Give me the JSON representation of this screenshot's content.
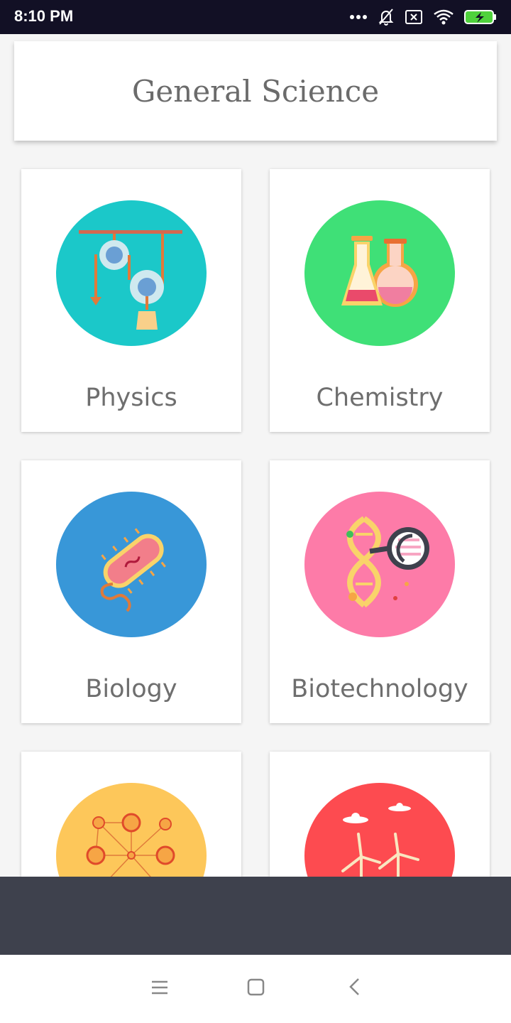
{
  "status_bar": {
    "time": "8:10 PM",
    "icons": [
      "more-dots-icon",
      "bell-off-icon",
      "sim-x-icon",
      "wifi-icon",
      "battery-charging-icon"
    ]
  },
  "header": {
    "title": "General Science"
  },
  "categories": [
    {
      "label": "Physics",
      "icon": "pulley-icon",
      "color": "#1bc8c9"
    },
    {
      "label": "Chemistry",
      "icon": "flasks-icon",
      "color": "#3fe077"
    },
    {
      "label": "Biology",
      "icon": "bacteria-icon",
      "color": "#3897d8"
    },
    {
      "label": "Biotechnology",
      "icon": "dna-magnifier-icon",
      "color": "#fd7ba8"
    },
    {
      "label": "",
      "icon": "network-nodes-icon",
      "color": "#fdc75a"
    },
    {
      "label": "",
      "icon": "wind-turbines-icon",
      "color": "#fd4b50"
    }
  ],
  "navbar": {
    "icons": [
      "menu-icon",
      "home-square-icon",
      "back-icon"
    ]
  }
}
